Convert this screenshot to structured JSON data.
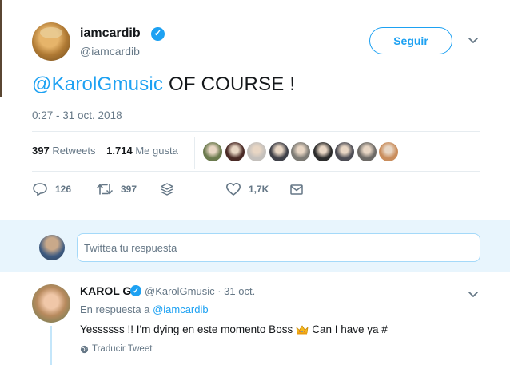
{
  "tweet": {
    "author": {
      "display_name": "iamcardib",
      "handle": "@iamcardib",
      "verified": true
    },
    "follow_label": "Seguir",
    "text": {
      "mention": "@KarolGmusic",
      "body": " OF COURSE !"
    },
    "timestamp": "0:27 - 31 oct. 2018",
    "stats": {
      "retweets_count": "397",
      "retweets_label": "Retweets",
      "likes_count": "1.714",
      "likes_label": "Me gusta"
    },
    "liker_avatars": [
      "#6b7a4e",
      "#4a2a26",
      "#c4c0bc",
      "#3f4048",
      "#7c7a74",
      "#2c2c2c",
      "#4d4d55",
      "#6d6a66",
      "#c98d5c"
    ],
    "actions": {
      "reply_count": "126",
      "retweet_count": "397",
      "like_count": "1,7K"
    }
  },
  "reply_box": {
    "placeholder": "Twittea tu respuesta"
  },
  "reply": {
    "display_name": "KAROL G",
    "handle_date": "@KarolGmusic · 31 oct.",
    "in_reply_prefix": "En respuesta a ",
    "in_reply_mention": "@iamcardib",
    "text_before": "Yessssss !! I'm dying en este momento Boss",
    "text_after": "Can I have ya #",
    "translate_label": "Traducir Tweet"
  },
  "colors": {
    "accent": "#1da1f2",
    "secondary_text": "#657786",
    "reply_box_bg": "#e8f5fd"
  }
}
